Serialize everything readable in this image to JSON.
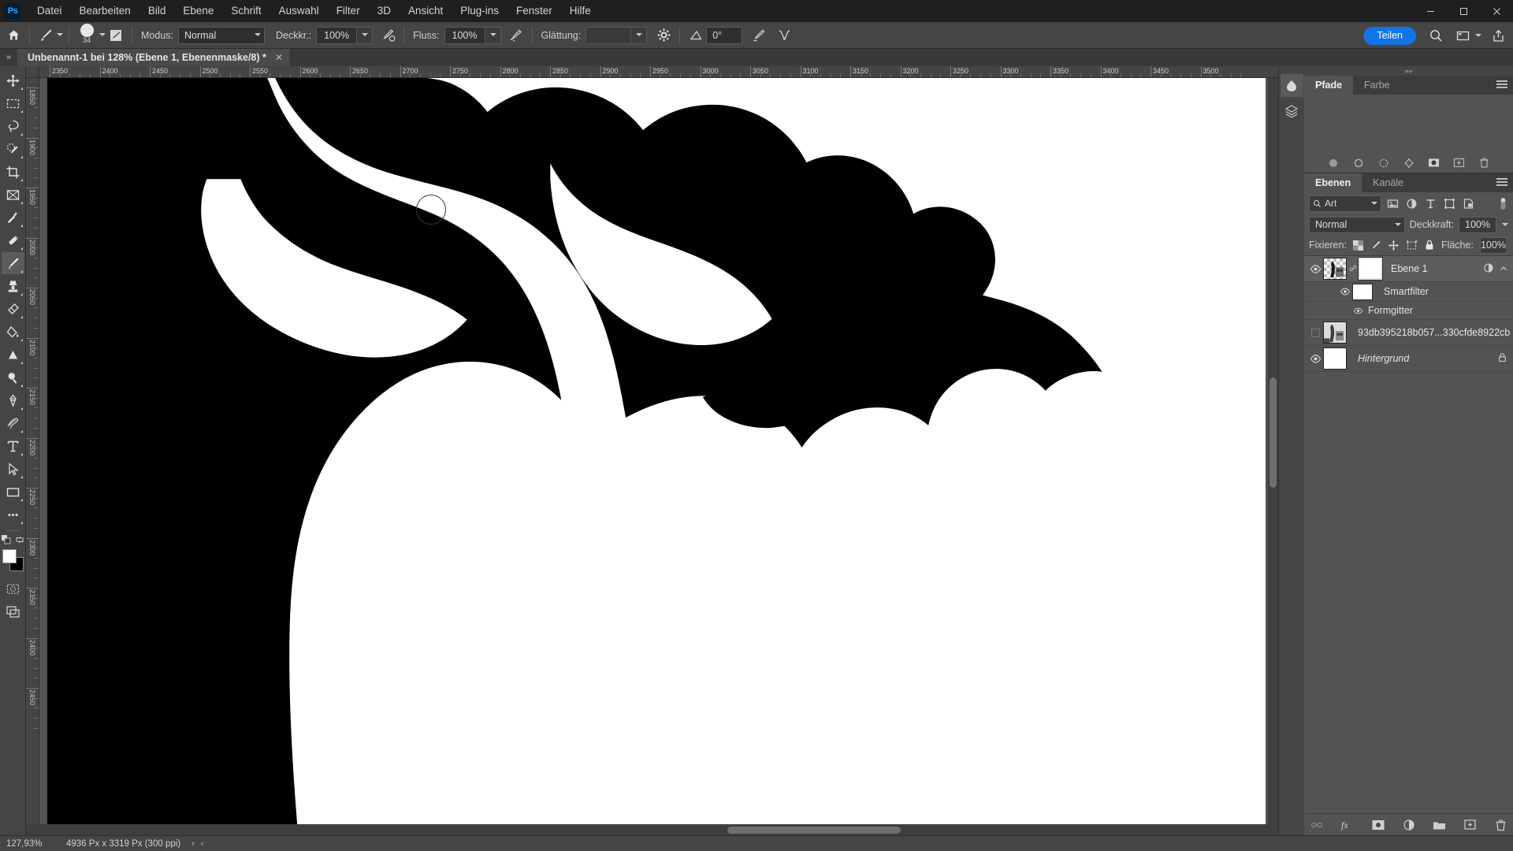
{
  "app": {
    "logo_text": "Ps",
    "accent_color": "#1473e6",
    "window_controls": [
      "minimize",
      "maximize",
      "close"
    ]
  },
  "menubar": {
    "items": [
      {
        "label": "Datei"
      },
      {
        "label": "Bearbeiten"
      },
      {
        "label": "Bild"
      },
      {
        "label": "Ebene"
      },
      {
        "label": "Schrift"
      },
      {
        "label": "Auswahl"
      },
      {
        "label": "Filter"
      },
      {
        "label": "3D"
      },
      {
        "label": "Ansicht"
      },
      {
        "label": "Plug-ins"
      },
      {
        "label": "Fenster"
      },
      {
        "label": "Hilfe"
      }
    ]
  },
  "options_bar": {
    "home_icon": "home-icon",
    "brush_tool_icon": "brush-icon",
    "brush_size": "34",
    "brush_settings_icon": "brush-settings-icon",
    "mode_label": "Modus:",
    "mode_value": "Normal",
    "opacity_label": "Deckkr.:",
    "opacity_value": "100%",
    "pressure_opacity_icon": "pressure-opacity-icon",
    "flow_label": "Fluss:",
    "flow_value": "100%",
    "airbrush_icon": "airbrush-icon",
    "smoothing_label": "Glättung:",
    "smoothing_value": "",
    "smoothing_gear_icon": "gear-icon",
    "angle_icon": "angle-icon",
    "angle_value": "0°",
    "pressure_size_icon": "pressure-size-icon",
    "symmetry_icon": "symmetry-icon",
    "share_label": "Teilen",
    "search_icon": "search-icon",
    "workspace_icon": "workspace-icon",
    "workspace_caret": "chevron-down-icon",
    "export_icon": "share-export-icon"
  },
  "tabbar": {
    "expand_icon": "chevron-double-right-icon",
    "document_title": "Unbenannt-1 bei 128% (Ebene 1, Ebenenmaske/8) *",
    "close_icon": "close-icon"
  },
  "toolbar": {
    "tools": [
      {
        "name": "move-tool",
        "icon": "move-icon",
        "active": false
      },
      {
        "name": "rectangular-marquee-tool",
        "icon": "marquee-icon",
        "active": false
      },
      {
        "name": "lasso-tool",
        "icon": "lasso-icon",
        "active": false
      },
      {
        "name": "object-selection-tool",
        "icon": "quick-select-icon",
        "active": false
      },
      {
        "name": "crop-tool",
        "icon": "crop-icon",
        "active": false
      },
      {
        "name": "frame-tool",
        "icon": "frame-icon",
        "active": false
      },
      {
        "name": "eyedropper-tool",
        "icon": "eyedropper-icon",
        "active": false
      },
      {
        "name": "healing-brush-tool",
        "icon": "healing-icon",
        "active": false
      },
      {
        "name": "brush-tool",
        "icon": "brush-icon",
        "active": true
      },
      {
        "name": "clone-stamp-tool",
        "icon": "stamp-icon",
        "active": false
      },
      {
        "name": "eraser-tool",
        "icon": "eraser-icon",
        "active": false
      },
      {
        "name": "gradient-tool",
        "icon": "paint-bucket-icon",
        "active": false
      },
      {
        "name": "blur-tool",
        "icon": "blur-triangle-icon",
        "active": false
      },
      {
        "name": "dodge-tool",
        "icon": "dodge-icon",
        "active": false
      },
      {
        "name": "pen-tool",
        "icon": "pen-icon",
        "active": false
      },
      {
        "name": "history-brush-tool",
        "icon": "history-brush-icon",
        "active": false
      },
      {
        "name": "type-tool",
        "icon": "type-icon",
        "active": false
      },
      {
        "name": "path-selection-tool",
        "icon": "path-arrow-icon",
        "active": false
      },
      {
        "name": "rectangle-tool",
        "icon": "rectangle-icon",
        "active": false
      },
      {
        "name": "more-tools",
        "icon": "ellipsis-icon",
        "active": false
      }
    ],
    "quickmask_icon": "quick-mask-icon",
    "screenmode_icon": "screen-mode-icon",
    "foreground_color": "#ffffff",
    "background_color": "#000000",
    "swap_icon": "swap-colors-icon",
    "default_icon": "default-colors-icon"
  },
  "rulers": {
    "horizontal_labels": [
      "2350",
      "2400",
      "2450",
      "2500",
      "2550",
      "2600",
      "2650",
      "2700",
      "2750",
      "2800",
      "2850",
      "2900",
      "2950",
      "3000",
      "3050",
      "3100",
      "3150",
      "3200",
      "3250",
      "3300",
      "3350",
      "3400",
      "3450",
      "3500"
    ],
    "vertical_labels": [
      "1850",
      "1900",
      "1950",
      "2000",
      "2050",
      "2100",
      "2150",
      "2200",
      "2250",
      "2300",
      "2350",
      "2400",
      "2450"
    ]
  },
  "right_dock": {
    "rail": [
      {
        "name": "properties-rail-button",
        "icon": "properties-icon",
        "selected": true
      },
      {
        "name": "libraries-rail-button",
        "icon": "layers-stack-icon",
        "selected": false
      }
    ],
    "paths_panel": {
      "tabs": [
        {
          "label": "Pfade",
          "active": true
        },
        {
          "label": "Farbe",
          "active": false
        }
      ],
      "menu_icon": "panel-menu-icon",
      "footer_icons": [
        "fill-path-icon",
        "stroke-path-icon",
        "load-selection-icon",
        "make-work-path-icon",
        "add-mask-icon",
        "new-path-icon",
        "delete-path-icon"
      ]
    },
    "layers_panel": {
      "tabs": [
        {
          "label": "Ebenen",
          "active": true
        },
        {
          "label": "Kanäle",
          "active": false
        }
      ],
      "menu_icon": "panel-menu-icon",
      "filter": {
        "search_icon": "search-icon",
        "value": "Art",
        "caret_icon": "chevron-down-icon",
        "type_icons": [
          "filter-pixel-icon",
          "filter-adjustment-icon",
          "filter-type-icon",
          "filter-shape-icon",
          "filter-smart-icon"
        ],
        "toggle_icon": "filter-toggle-icon"
      },
      "blend": {
        "mode_value": "Normal",
        "caret_icon": "chevron-down-icon",
        "opacity_label": "Deckkraft:",
        "opacity_value": "100%",
        "opacity_caret": "chevron-down-icon"
      },
      "lock": {
        "label": "Fixieren:",
        "icons": [
          "lock-transparency-icon",
          "lock-image-icon",
          "lock-position-icon",
          "lock-artboard-icon",
          "lock-all-icon"
        ],
        "fill_label": "Fläche:",
        "fill_value": "100%",
        "fill_caret": "chevron-down-icon"
      },
      "layers": [
        {
          "name": "Ebene 1",
          "visible": true,
          "selected": true,
          "has_mask": true,
          "linked": true,
          "thumb": "checker",
          "italic": false,
          "right_icons": [
            "smart-object-badge-icon",
            "chevron-up-icon"
          ],
          "children": [
            {
              "name": "Smartfilter",
              "visible": true,
              "kind": "filter-header"
            },
            {
              "name": "Formgitter",
              "visible": true,
              "kind": "filter-entry"
            }
          ]
        },
        {
          "name": "93db395218b057...330cfde8922cb",
          "visible": false,
          "selected": false,
          "has_mask": false,
          "thumb": "image",
          "italic": false,
          "right_icons": [],
          "children": []
        },
        {
          "name": "Hintergrund",
          "visible": true,
          "selected": false,
          "has_mask": false,
          "thumb": "white",
          "italic": true,
          "right_icons": [
            "lock-icon"
          ],
          "children": []
        }
      ],
      "footer_icons": [
        "link-layers-icon",
        "layer-style-fx-icon",
        "add-layer-mask-icon",
        "adjustment-layer-icon",
        "new-group-icon",
        "new-layer-icon",
        "delete-layer-icon"
      ]
    }
  },
  "statusbar": {
    "zoom": "127,93%",
    "dimensions": "4936 Px x 3319 Px (300 ppi)",
    "next_arrow": "chevron-right-icon",
    "prev_arrow": "chevron-left-icon"
  }
}
